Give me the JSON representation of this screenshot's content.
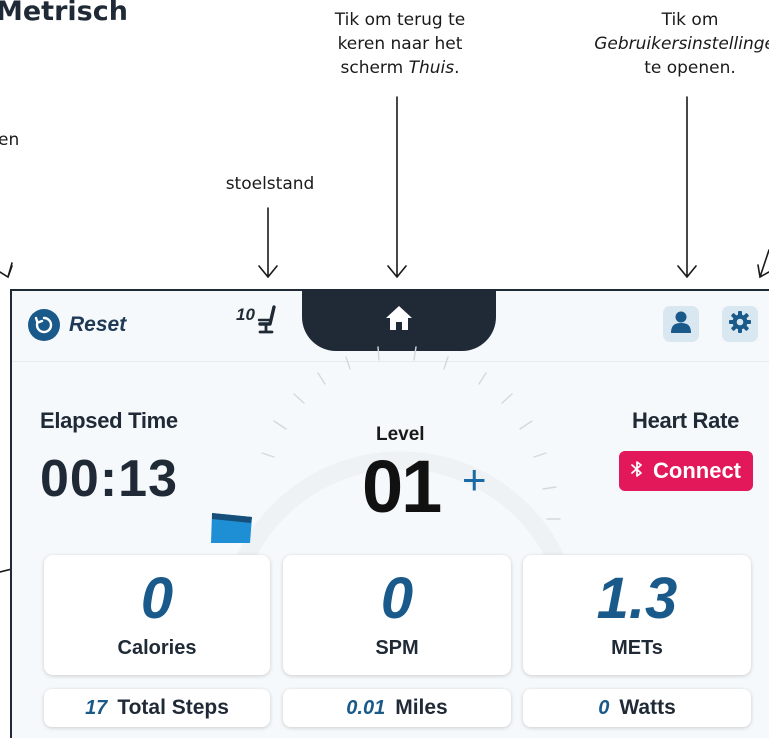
{
  "annotations": {
    "title": "Metrisch",
    "partial_left": "en",
    "seat_caption": "stoelstand",
    "home_line1": "Tik om terug te",
    "home_line2": "keren naar het",
    "home_line3_plain": "scherm ",
    "home_line3_italic": "Thuis",
    "home_line3_end": ".",
    "user_line1": "Tik om",
    "user_line2_italic": "Gebruikersinstellingen",
    "user_line3": "te openen."
  },
  "topbar": {
    "reset_label": "Reset",
    "seat_position": "10",
    "icons": {
      "reset": "reset-circular-arrow-icon",
      "seat": "seat-icon",
      "home": "home-icon",
      "user": "user-icon",
      "settings": "gear-icon"
    }
  },
  "metrics": {
    "elapsed_label": "Elapsed Time",
    "elapsed_value": "00:13",
    "level_label": "Level",
    "level_value": "01",
    "level_plus": "+",
    "heart_label": "Heart Rate",
    "connect_label": "Connect",
    "connect_icon": "bluetooth-icon"
  },
  "cards": [
    {
      "value": "0",
      "label": "Calories"
    },
    {
      "value": "0",
      "label": "SPM"
    },
    {
      "value": "1.3",
      "label": "METs"
    }
  ],
  "summary": [
    {
      "value": "17",
      "label": "Total Steps"
    },
    {
      "value": "0.01",
      "label": "Miles"
    },
    {
      "value": "0",
      "label": "Watts"
    }
  ],
  "colors": {
    "navy": "#1f2a36",
    "accent_blue": "#1a5a8a",
    "bluetooth_pink": "#e2185a",
    "icon_bg": "#d9e7f1",
    "level_marker": "#1e8fd4"
  }
}
